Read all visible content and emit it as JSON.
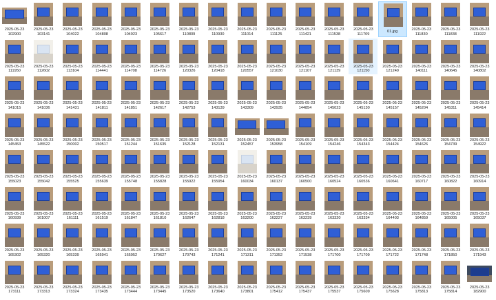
{
  "colors": {
    "background": "#ffffff",
    "selected": "#cce8ff",
    "hover": "#e5f3ff",
    "screen": "#2f5fd6"
  },
  "files": [
    {
      "date": "2025-05-23",
      "time": "102900",
      "variant": "landscape"
    },
    {
      "date": "2025-05-23",
      "time": "103141"
    },
    {
      "date": "2025-05-23",
      "time": "104022"
    },
    {
      "date": "2025-05-23",
      "time": "104808"
    },
    {
      "date": "2025-05-23",
      "time": "104923"
    },
    {
      "date": "2025-05-23",
      "time": "105617"
    },
    {
      "date": "2025-05-23",
      "time": "110809"
    },
    {
      "date": "2025-05-23",
      "time": "110930"
    },
    {
      "date": "2025-05-23",
      "time": "111014"
    },
    {
      "date": "2025-05-23",
      "time": "111125"
    },
    {
      "date": "2025-05-23",
      "time": "111421"
    },
    {
      "date": "2025-05-23",
      "time": "111538"
    },
    {
      "date": "2025-05-23",
      "time": "111709"
    },
    {
      "name": "01.jpg",
      "selected": true
    },
    {
      "date": "2025-05-23",
      "time": "111830"
    },
    {
      "date": "2025-05-23",
      "time": "111838"
    },
    {
      "date": "2025-05-23",
      "time": "111922"
    },
    {
      "date": "2025-05-23",
      "time": "111950"
    },
    {
      "date": "2025-05-23",
      "time": "112602",
      "variant": "white"
    },
    {
      "date": "2025-05-23",
      "time": "113104"
    },
    {
      "date": "2025-05-23",
      "time": "114441"
    },
    {
      "date": "2025-05-23",
      "time": "114708"
    },
    {
      "date": "2025-05-23",
      "time": "114726"
    },
    {
      "date": "2025-05-23",
      "time": "120326"
    },
    {
      "date": "2025-05-23",
      "time": "120418"
    },
    {
      "date": "2025-05-23",
      "time": "120557"
    },
    {
      "date": "2025-05-23",
      "time": "121030"
    },
    {
      "date": "2025-05-23",
      "time": "121107"
    },
    {
      "date": "2025-05-23",
      "time": "121139"
    },
    {
      "date": "2025-05-23",
      "time": "121150",
      "hover": true
    },
    {
      "date": "2025-05-23",
      "time": "121240"
    },
    {
      "date": "2025-05-23",
      "time": "140111"
    },
    {
      "date": "2025-05-23",
      "time": "140645"
    },
    {
      "date": "2025-05-23",
      "time": "140802"
    },
    {
      "date": "2025-05-23",
      "time": "141015"
    },
    {
      "date": "2025-05-23",
      "time": "141036"
    },
    {
      "date": "2025-05-23",
      "time": "141431"
    },
    {
      "date": "2025-05-23",
      "time": "141811"
    },
    {
      "date": "2025-05-23",
      "time": "141851"
    },
    {
      "date": "2025-05-23",
      "time": "142617"
    },
    {
      "date": "2025-05-23",
      "time": "142753"
    },
    {
      "date": "2025-05-23",
      "time": "143139"
    },
    {
      "date": "2025-05-23",
      "time": "143309"
    },
    {
      "date": "2025-05-23",
      "time": "143935"
    },
    {
      "date": "2025-05-23",
      "time": "144854"
    },
    {
      "date": "2025-05-23",
      "time": "145023"
    },
    {
      "date": "2025-05-23",
      "time": "145130"
    },
    {
      "date": "2025-05-23",
      "time": "145157"
    },
    {
      "date": "2025-05-23",
      "time": "145204"
    },
    {
      "date": "2025-05-23",
      "time": "145311"
    },
    {
      "date": "2025-05-23",
      "time": "145414"
    },
    {
      "date": "2025-05-23",
      "time": "145453"
    },
    {
      "date": "2025-05-23",
      "time": "145522"
    },
    {
      "date": "2025-05-23",
      "time": "150002"
    },
    {
      "date": "2025-05-23",
      "time": "150517"
    },
    {
      "date": "2025-05-23",
      "time": "151244"
    },
    {
      "date": "2025-05-23",
      "time": "151635"
    },
    {
      "date": "2025-05-23",
      "time": "152128"
    },
    {
      "date": "2025-05-23",
      "time": "152131"
    },
    {
      "date": "2025-05-23",
      "time": "152457",
      "variant": "landscape"
    },
    {
      "date": "2025-05-23",
      "time": "153958",
      "variant": "landscape"
    },
    {
      "date": "2025-05-23",
      "time": "154109"
    },
    {
      "date": "2025-05-23",
      "time": "154246"
    },
    {
      "date": "2025-05-23",
      "time": "154343"
    },
    {
      "date": "2025-05-23",
      "time": "154424"
    },
    {
      "date": "2025-05-23",
      "time": "154626"
    },
    {
      "date": "2025-05-23",
      "time": "154739"
    },
    {
      "date": "2025-05-23",
      "time": "154922"
    },
    {
      "date": "2025-05-23",
      "time": "155023"
    },
    {
      "date": "2025-05-23",
      "time": "155042"
    },
    {
      "date": "2025-05-23",
      "time": "155525"
    },
    {
      "date": "2025-05-23",
      "time": "155639"
    },
    {
      "date": "2025-05-23",
      "time": "155748"
    },
    {
      "date": "2025-05-23",
      "time": "155828"
    },
    {
      "date": "2025-05-23",
      "time": "155922"
    },
    {
      "date": "2025-05-23",
      "time": "155954"
    },
    {
      "date": "2025-05-23",
      "time": "160034",
      "variant": "white"
    },
    {
      "date": "2025-05-23",
      "time": "160137"
    },
    {
      "date": "2025-05-23",
      "time": "160500"
    },
    {
      "date": "2025-05-23",
      "time": "160524"
    },
    {
      "date": "2025-05-23",
      "time": "160536"
    },
    {
      "date": "2025-05-23",
      "time": "160641"
    },
    {
      "date": "2025-05-23",
      "time": "160717"
    },
    {
      "date": "2025-05-23",
      "time": "160822"
    },
    {
      "date": "2025-05-23",
      "time": "160914"
    },
    {
      "date": "2025-05-23",
      "time": "160939"
    },
    {
      "date": "2025-05-23",
      "time": "161007"
    },
    {
      "date": "2025-05-23",
      "time": "161111"
    },
    {
      "date": "2025-05-23",
      "time": "161519"
    },
    {
      "date": "2025-05-23",
      "time": "161847"
    },
    {
      "date": "2025-05-23",
      "time": "161810"
    },
    {
      "date": "2025-05-23",
      "time": "162647"
    },
    {
      "date": "2025-05-23",
      "time": "162818"
    },
    {
      "date": "2025-05-23",
      "time": "163200"
    },
    {
      "date": "2025-05-23",
      "time": "163227"
    },
    {
      "date": "2025-05-23",
      "time": "163239"
    },
    {
      "date": "2025-05-23",
      "time": "163320"
    },
    {
      "date": "2025-05-23",
      "time": "163334"
    },
    {
      "date": "2025-05-23",
      "time": "164403"
    },
    {
      "date": "2025-05-23",
      "time": "164859"
    },
    {
      "date": "2025-05-23",
      "time": "165005"
    },
    {
      "date": "2025-05-23",
      "time": "165037"
    },
    {
      "date": "2025-05-23",
      "time": "165302"
    },
    {
      "date": "2025-05-23",
      "time": "165320"
    },
    {
      "date": "2025-05-23",
      "time": "165339"
    },
    {
      "date": "2025-05-23",
      "time": "165941"
    },
    {
      "date": "2025-05-23",
      "time": "165952"
    },
    {
      "date": "2025-05-23",
      "time": "170627"
    },
    {
      "date": "2025-05-23",
      "time": "170743"
    },
    {
      "date": "2025-05-23",
      "time": "171241"
    },
    {
      "date": "2025-05-23",
      "time": "171311"
    },
    {
      "date": "2025-05-23",
      "time": "171352"
    },
    {
      "date": "2025-05-23",
      "time": "171538"
    },
    {
      "date": "2025-05-23",
      "time": "171700"
    },
    {
      "date": "2025-05-23",
      "time": "171709"
    },
    {
      "date": "2025-05-23",
      "time": "171722"
    },
    {
      "date": "2025-05-23",
      "time": "171748"
    },
    {
      "date": "2025-05-23",
      "time": "171850"
    },
    {
      "date": "2025-05-23",
      "time": "171943"
    },
    {
      "date": "2025-05-23",
      "time": "173111"
    },
    {
      "date": "2025-05-23",
      "time": "173313"
    },
    {
      "date": "2025-05-23",
      "time": "173324"
    },
    {
      "date": "2025-05-23",
      "time": "173435"
    },
    {
      "date": "2025-05-23",
      "time": "173444"
    },
    {
      "date": "2025-05-23",
      "time": "173445"
    },
    {
      "date": "2025-05-23",
      "time": "173520"
    },
    {
      "date": "2025-05-23",
      "time": "173640"
    },
    {
      "date": "2025-05-23",
      "time": "173801"
    },
    {
      "date": "2025-05-23",
      "time": "175412"
    },
    {
      "date": "2025-05-23",
      "time": "175437"
    },
    {
      "date": "2025-05-23",
      "time": "175537"
    },
    {
      "date": "2025-05-23",
      "time": "175609"
    },
    {
      "date": "2025-05-23",
      "time": "175628"
    },
    {
      "date": "2025-05-23",
      "time": "175813"
    },
    {
      "date": "2025-05-23",
      "time": "175814"
    },
    {
      "date": "2025-05-23",
      "time": "182900",
      "variant": "landscape-dark"
    }
  ]
}
